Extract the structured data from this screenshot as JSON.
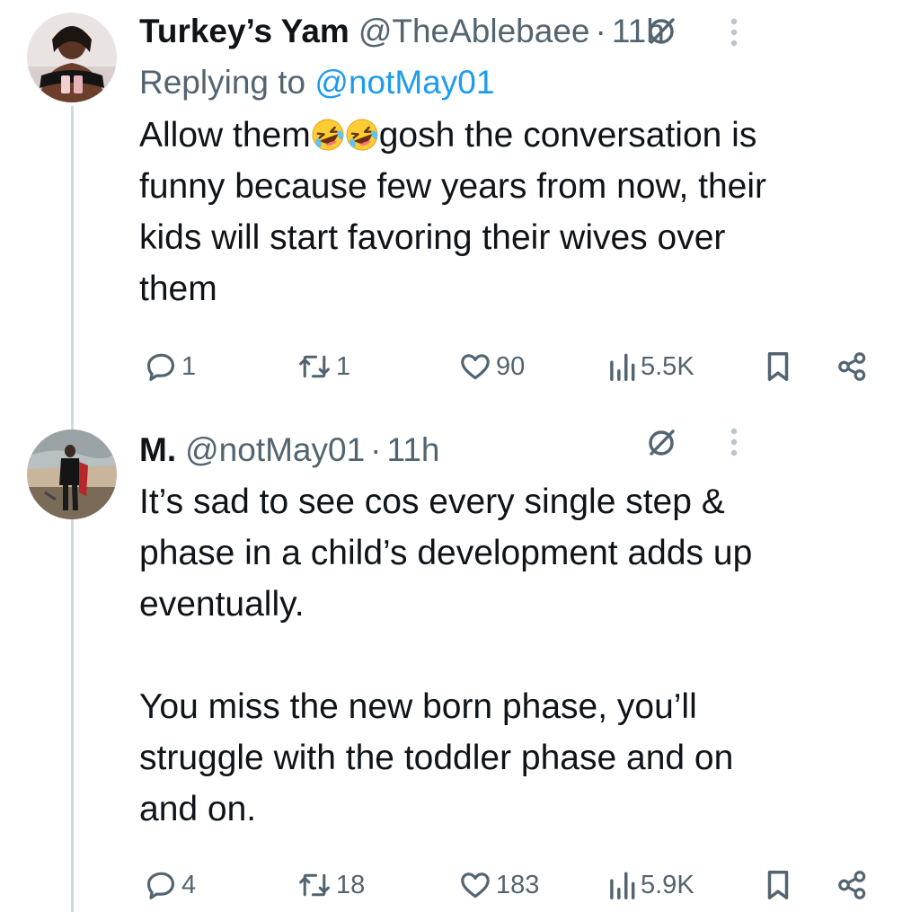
{
  "thread": [
    {
      "display_name": "Turkey’s Yam",
      "handle": "@TheAblebaee",
      "separator": "·",
      "time": "11h",
      "replying_label": "Replying to ",
      "replying_to": "@notMay01",
      "text_before_emoji": "Allow them",
      "emoji": [
        "rolling-on-floor-laughing",
        "rolling-on-floor-laughing"
      ],
      "text_after_emoji": "gosh the conversation is\nfunny because few years from now, their\nkids will start favoring their wives over\nthem",
      "replies": "1",
      "reposts": "1",
      "likes": "90",
      "views": "5.5K"
    },
    {
      "display_name": "M.",
      "handle": "@notMay01",
      "separator": "·",
      "time": "11h",
      "text": "It’s sad to see cos every single step &\nphase in a child’s development adds up\neventually.\n\nYou miss the new born phase, you’ll\nstruggle with the toddler phase and on\nand on.",
      "replies": "4",
      "reposts": "18",
      "likes": "183",
      "views": "5.9K"
    }
  ],
  "colors": {
    "text": "#0f1419",
    "secondary": "#536471",
    "link": "#1d9bf0",
    "thread_line": "#cfd9de"
  }
}
